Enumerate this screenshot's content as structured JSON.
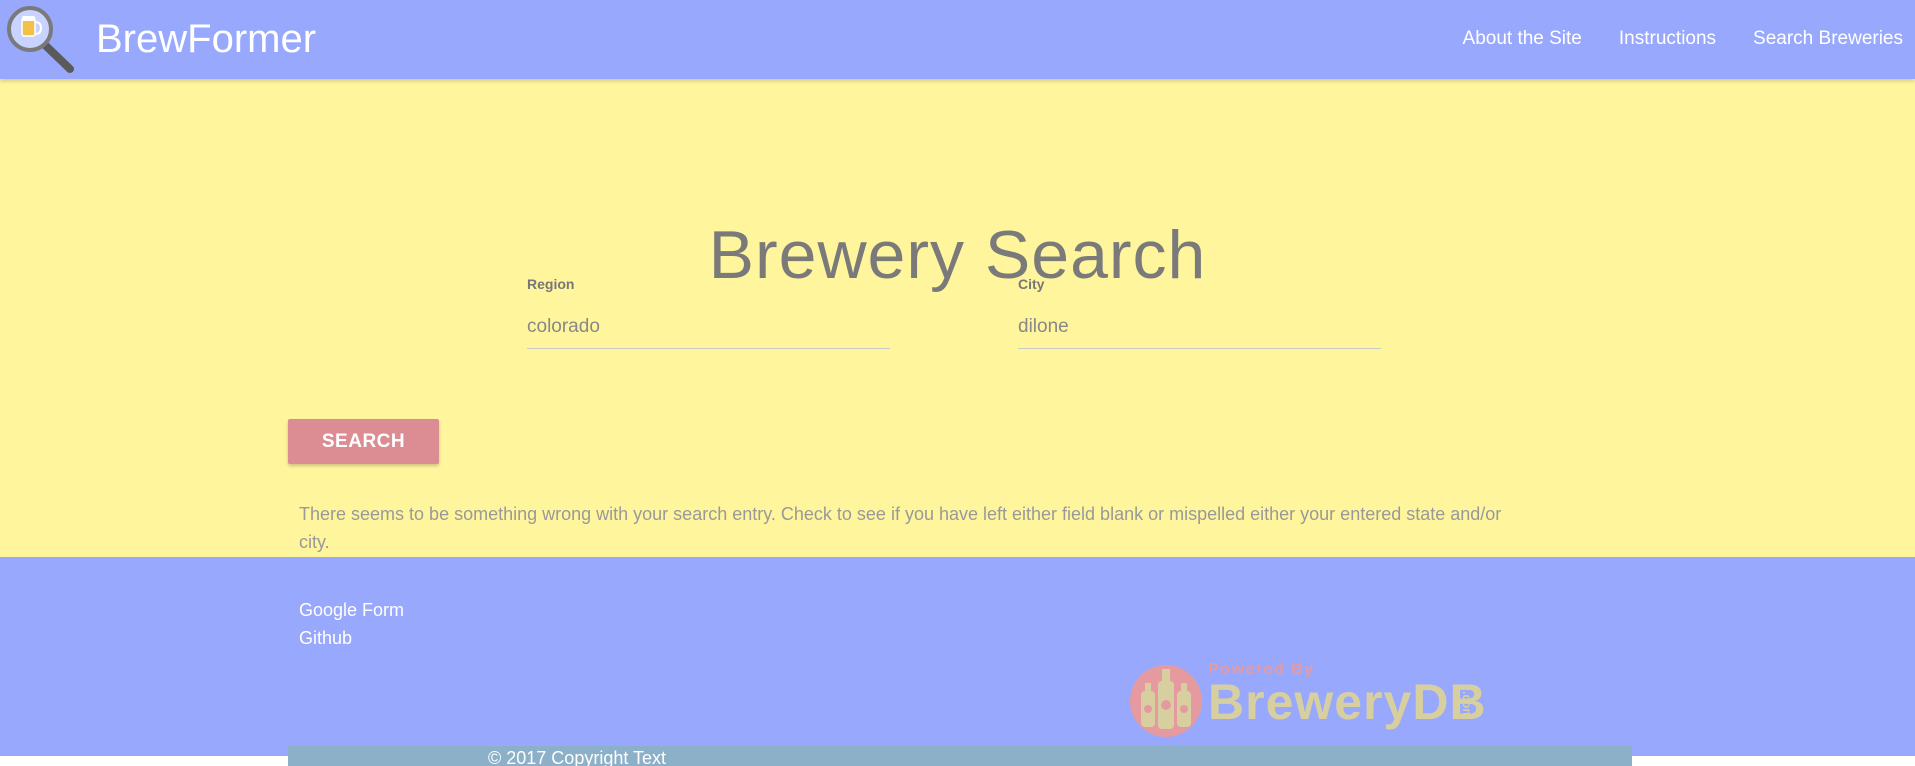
{
  "navbar": {
    "brand": "BrewFormer",
    "links": [
      "About the Site",
      "Instructions",
      "Search Breweries"
    ]
  },
  "main": {
    "title": "Brewery Search",
    "region": {
      "label": "Region",
      "value": "colorado"
    },
    "city": {
      "label": "City",
      "value": "dilone"
    },
    "search_label": "SEARCH",
    "error_message": "There seems to be something wrong with your search entry. Check to see if you have left either field blank or mispelled either your entered state and/or city."
  },
  "footer": {
    "links": [
      "Google Form",
      "Github"
    ],
    "logo": {
      "powered_by": "Powered By",
      "name": "BreweryDB",
      "suffix": ".com"
    },
    "copyright": "© 2017 Copyright Text"
  },
  "colors": {
    "nav_bg": "#98a8fd",
    "main_bg": "#fff59d",
    "button_bg": "#dc8d93",
    "copyright_bg": "#8cb0c8"
  },
  "icons": {
    "logo": "magnifying-glass-beer-icon",
    "brewerydb": "beer-bottles-icon"
  }
}
